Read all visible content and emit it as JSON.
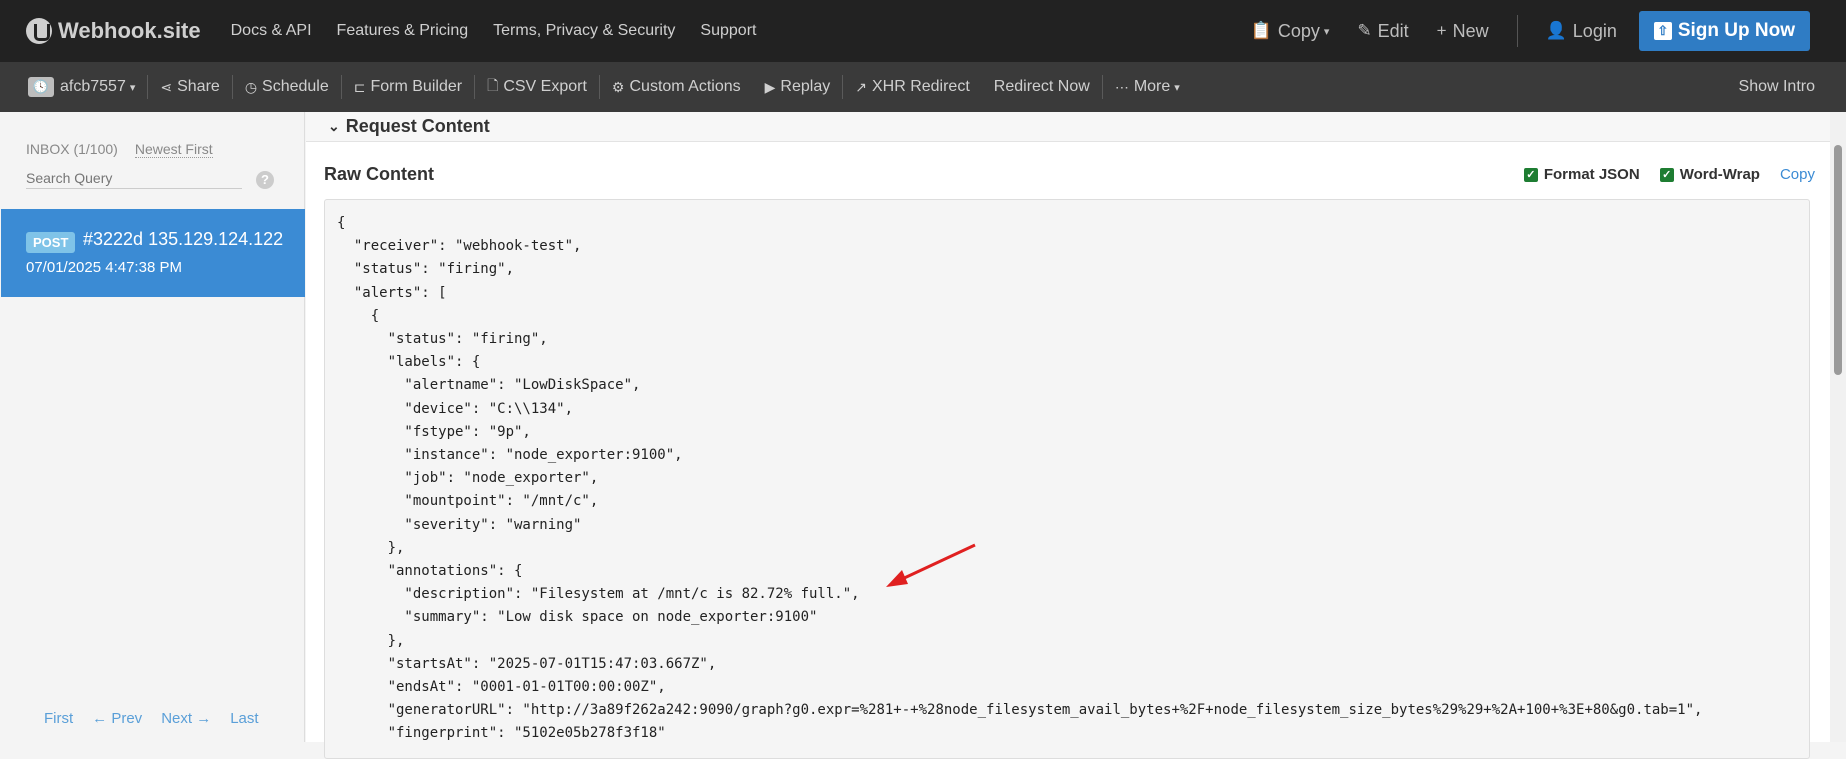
{
  "app": {
    "brand": "Webhook.site"
  },
  "topnav": [
    "Docs & API",
    "Features & Pricing",
    "Terms, Privacy & Security",
    "Support"
  ],
  "top_actions": {
    "copy": "Copy",
    "edit": "Edit",
    "new": "New",
    "login": "Login",
    "signup": "Sign Up Now"
  },
  "toolbar": {
    "token": "afcb7557",
    "share": "Share",
    "schedule": "Schedule",
    "form_builder": "Form Builder",
    "csv_export": "CSV Export",
    "custom_actions": "Custom Actions",
    "replay": "Replay",
    "xhr_redirect": "XHR Redirect",
    "redirect_now": "Redirect Now",
    "more": "More",
    "show_intro": "Show Intro"
  },
  "sidebar": {
    "inbox": "INBOX (1/100)",
    "sort": "Newest First",
    "search_placeholder": "Search Query",
    "help": "?",
    "request": {
      "method": "POST",
      "title": "#3222d 135.129.124.122",
      "date": "07/01/2025 4:47:38 PM"
    },
    "pager": [
      "First",
      "← Prev",
      "Next →",
      "Last"
    ]
  },
  "main": {
    "section_title": "Request Content",
    "raw_title": "Raw Content",
    "format_json": "Format JSON",
    "word_wrap": "Word-Wrap",
    "copy": "Copy",
    "code_lines": [
      "{",
      "  \"receiver\": \"webhook-test\",",
      "  \"status\": \"firing\",",
      "  \"alerts\": [",
      "    {",
      "      \"status\": \"firing\",",
      "      \"labels\": {",
      "        \"alertname\": \"LowDiskSpace\",",
      "        \"device\": \"C:\\\\134\",",
      "        \"fstype\": \"9p\",",
      "        \"instance\": \"node_exporter:9100\",",
      "        \"job\": \"node_exporter\",",
      "        \"mountpoint\": \"/mnt/c\",",
      "        \"severity\": \"warning\"",
      "      },",
      "      \"annotations\": {",
      "        \"description\": \"Filesystem at /mnt/c is 82.72% full.\",",
      "        \"summary\": \"Low disk space on node_exporter:9100\"",
      "      },",
      "      \"startsAt\": \"2025-07-01T15:47:03.667Z\",",
      "      \"endsAt\": \"0001-01-01T00:00:00Z\",",
      "      \"generatorURL\": \"http://3a89f262a242:9090/graph?g0.expr=%281+-+%28node_filesystem_avail_bytes+%2F+node_filesystem_size_bytes%29%29+%2A+100+%3E+80&g0.tab=1\",",
      "      \"fingerprint\": \"5102e05b278f3f18\""
    ]
  },
  "colors": {
    "topbar": "#222222",
    "toolbar": "#3a3a3a",
    "accent": "#3b8bd4",
    "signup": "#2f7cc4",
    "annotation_arrow": "#e02020"
  }
}
